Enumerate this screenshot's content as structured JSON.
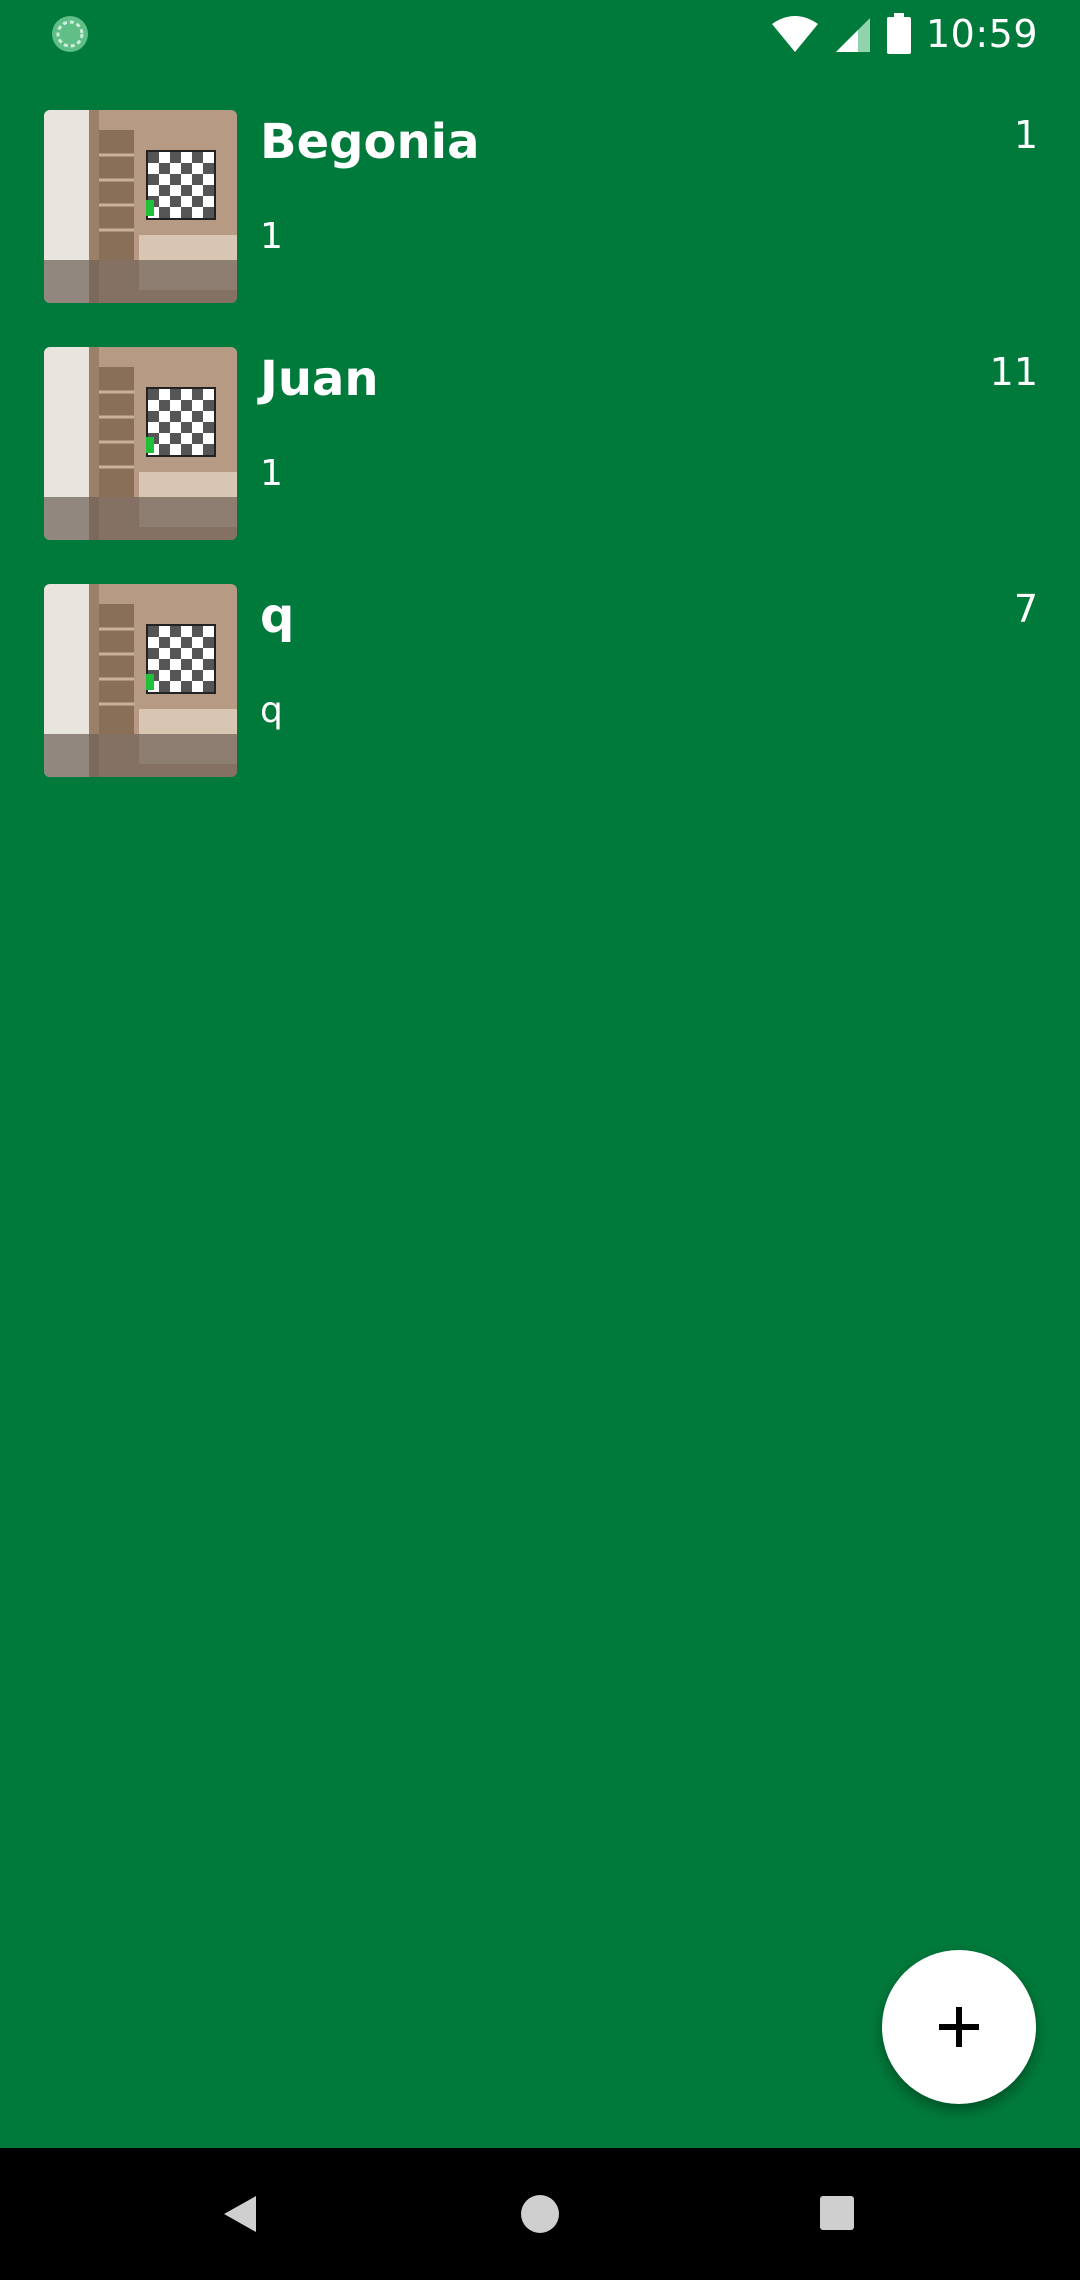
{
  "status_bar": {
    "time": "10:59",
    "icons": [
      "loading-icon",
      "wifi-icon",
      "signal-icon",
      "battery-icon"
    ]
  },
  "items": [
    {
      "title": "Begonia",
      "subtitle": "1",
      "count": "1",
      "thumbnail": "room-image"
    },
    {
      "title": "Juan",
      "subtitle": "1",
      "count": "11",
      "thumbnail": "room-image"
    },
    {
      "title": "q",
      "subtitle": "q",
      "count": "7",
      "thumbnail": "room-image"
    }
  ],
  "fab": {
    "icon": "plus-icon"
  },
  "nav_bar": {
    "icons": [
      "back-icon",
      "home-icon",
      "recents-icon"
    ]
  },
  "colors": {
    "background": "#007a3a",
    "text": "#ffffff",
    "fab": "#ffffff",
    "nav_bar": "#000000"
  }
}
